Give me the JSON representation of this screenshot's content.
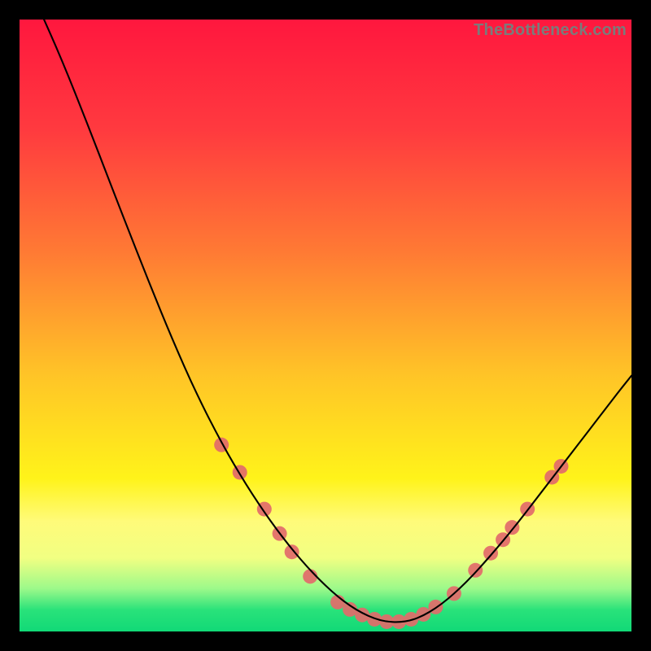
{
  "watermark": "TheBottleneck.com",
  "chart_data": {
    "type": "line",
    "title": "",
    "xlabel": "",
    "ylabel": "",
    "xlim": [
      0,
      100
    ],
    "ylim": [
      0,
      100
    ],
    "grid": false,
    "legend": false,
    "background_gradient": {
      "orientation": "vertical",
      "stops": [
        {
          "offset": 0.0,
          "color": "#ff173e"
        },
        {
          "offset": 0.18,
          "color": "#ff3a3f"
        },
        {
          "offset": 0.38,
          "color": "#ff7a34"
        },
        {
          "offset": 0.58,
          "color": "#ffc427"
        },
        {
          "offset": 0.75,
          "color": "#fff31a"
        },
        {
          "offset": 0.82,
          "color": "#fffb7a"
        },
        {
          "offset": 0.88,
          "color": "#f1ff82"
        },
        {
          "offset": 0.93,
          "color": "#9cf98a"
        },
        {
          "offset": 0.965,
          "color": "#29e27a"
        },
        {
          "offset": 1.0,
          "color": "#11d977"
        }
      ]
    },
    "series": [
      {
        "name": "bottleneck-curve",
        "color": "#000000",
        "stroke_width": 2.1,
        "x": [
          4,
          6,
          8,
          10,
          12,
          14,
          16,
          18,
          20,
          22,
          24,
          26,
          28,
          30,
          32,
          34,
          36,
          38,
          40,
          42,
          44,
          46,
          48,
          50,
          52,
          54,
          56,
          58,
          60,
          62,
          64,
          66,
          68,
          70,
          72,
          74,
          76,
          78,
          80,
          82,
          84,
          86,
          88,
          90,
          92,
          94,
          96,
          98,
          100
        ],
        "y": [
          100,
          95.5,
          90.7,
          85.7,
          80.6,
          75.4,
          70.2,
          65.1,
          60.0,
          55.0,
          50.1,
          45.4,
          40.9,
          36.7,
          32.8,
          29.1,
          25.7,
          22.5,
          19.5,
          16.7,
          14.1,
          11.7,
          9.5,
          7.5,
          5.7,
          4.2,
          3.0,
          2.1,
          1.6,
          1.5,
          1.8,
          2.6,
          3.8,
          5.3,
          7.1,
          9.1,
          11.3,
          13.6,
          16.0,
          18.5,
          21.1,
          23.7,
          26.3,
          28.9,
          31.5,
          34.1,
          36.7,
          39.3,
          41.8
        ]
      }
    ],
    "markers": {
      "name": "highlight-dots",
      "color": "#e26a6a",
      "radius": 9,
      "points": [
        {
          "x": 33,
          "y": 30.5
        },
        {
          "x": 36,
          "y": 26.0
        },
        {
          "x": 40,
          "y": 20.0
        },
        {
          "x": 42.5,
          "y": 16.0
        },
        {
          "x": 44.5,
          "y": 13.0
        },
        {
          "x": 47.5,
          "y": 9.0
        },
        {
          "x": 52,
          "y": 4.8
        },
        {
          "x": 54,
          "y": 3.6
        },
        {
          "x": 56,
          "y": 2.7
        },
        {
          "x": 58,
          "y": 2.0
        },
        {
          "x": 60,
          "y": 1.6
        },
        {
          "x": 62,
          "y": 1.6
        },
        {
          "x": 64,
          "y": 2.0
        },
        {
          "x": 66,
          "y": 2.8
        },
        {
          "x": 68,
          "y": 4.0
        },
        {
          "x": 71,
          "y": 6.2
        },
        {
          "x": 74.5,
          "y": 10.0
        },
        {
          "x": 77,
          "y": 12.8
        },
        {
          "x": 79,
          "y": 15.0
        },
        {
          "x": 80.5,
          "y": 17.0
        },
        {
          "x": 83,
          "y": 20.0
        },
        {
          "x": 87,
          "y": 25.2
        },
        {
          "x": 88.5,
          "y": 27.0
        }
      ]
    }
  }
}
